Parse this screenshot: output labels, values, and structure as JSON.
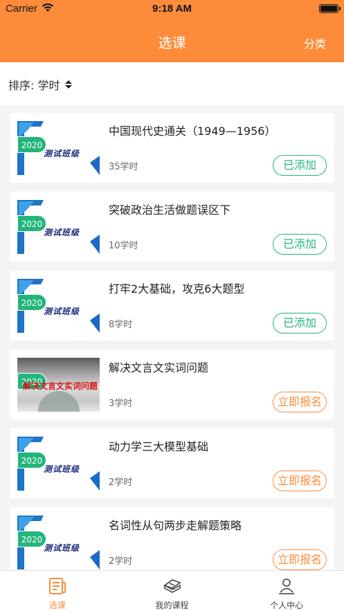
{
  "status": {
    "carrier": "Carrier",
    "time": "9:18 AM"
  },
  "nav": {
    "title": "选课",
    "right_action": "分类"
  },
  "sort": {
    "label": "排序: 学时"
  },
  "courses": [
    {
      "title": "中国现代史通关（1949—1956）",
      "hours": "35学时",
      "action": "已添加",
      "state": "added",
      "thumb_badge": "2020",
      "thumb_text": "测试班级"
    },
    {
      "title": "突破政治生活做题误区下",
      "hours": "10学时",
      "action": "已添加",
      "state": "added",
      "thumb_badge": "2020",
      "thumb_text": "测试班级"
    },
    {
      "title": "打牢2大基础，攻克6大题型",
      "hours": "8学时",
      "action": "已添加",
      "state": "added",
      "thumb_badge": "2020",
      "thumb_text": "测试班级"
    },
    {
      "title": "解决文言文实词问题",
      "hours": "3学时",
      "action": "立即报名",
      "state": "enroll",
      "thumb_badge": "2020",
      "thumb_text": "解决文言文实词问题"
    },
    {
      "title": "动力学三大模型基础",
      "hours": "2学时",
      "action": "立即报名",
      "state": "enroll",
      "thumb_badge": "2020",
      "thumb_text": "测试班级"
    },
    {
      "title": "名词性从句两步走解题策略",
      "hours": "2学时",
      "action": "立即报名",
      "state": "enroll",
      "thumb_badge": "2020",
      "thumb_text": "测试班级"
    }
  ],
  "tabs": [
    {
      "label": "选课",
      "icon": "course-select-icon",
      "active": true
    },
    {
      "label": "我的课程",
      "icon": "my-courses-icon",
      "active": false
    },
    {
      "label": "个人中心",
      "icon": "profile-icon",
      "active": false
    }
  ],
  "colors": {
    "brand": "#fd8c3a",
    "added": "#22b57a"
  }
}
